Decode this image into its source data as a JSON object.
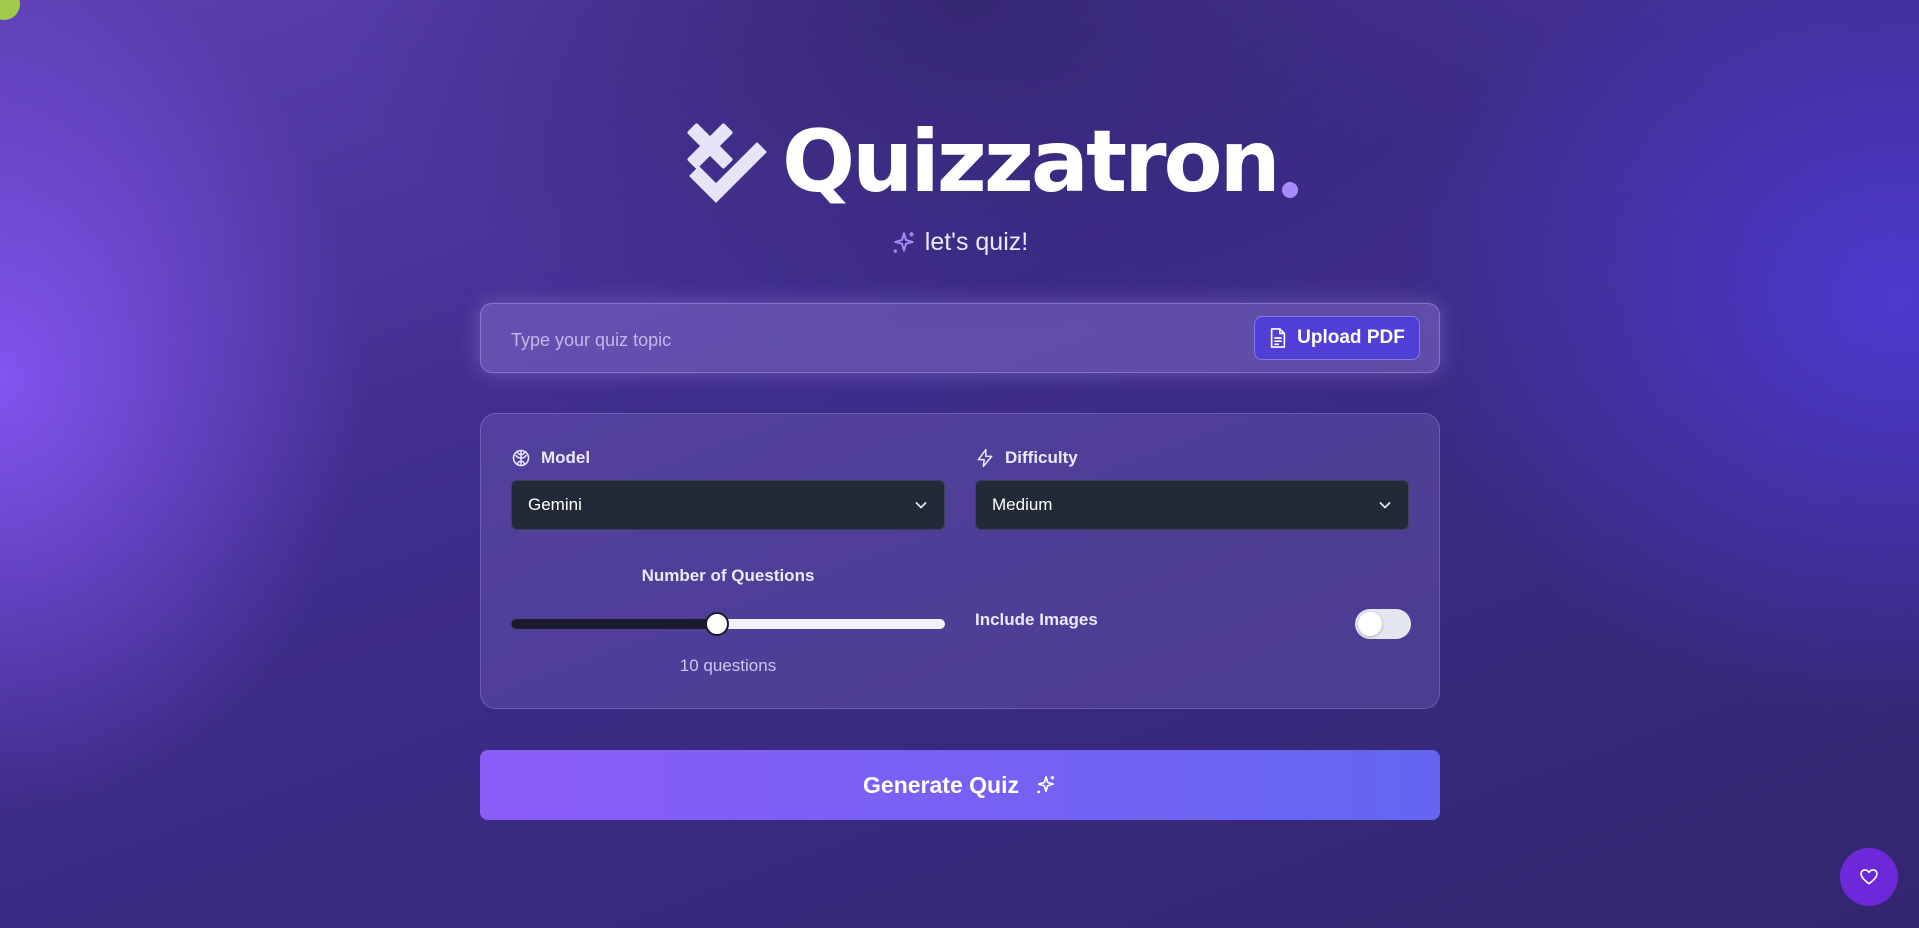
{
  "brand": {
    "name": "Quizzatron",
    "tagline": "let's quiz!",
    "dot_color": "#a78bfa",
    "logo_icon": "x-check-logo-icon"
  },
  "topic": {
    "placeholder": "Type your quiz topic",
    "value": "",
    "upload_label": "Upload PDF",
    "upload_icon": "file-icon"
  },
  "settings": {
    "model": {
      "label": "Model",
      "icon": "brain-icon",
      "selected": "Gemini"
    },
    "difficulty": {
      "label": "Difficulty",
      "icon": "zap-icon",
      "selected": "Medium"
    },
    "questions": {
      "label": "Number of Questions",
      "value": 10,
      "slider_fraction": 0.475,
      "value_text": "10 questions"
    },
    "images": {
      "label": "Include Images",
      "enabled": false
    }
  },
  "actions": {
    "generate_label": "Generate Quiz",
    "generate_icon": "sparkles-icon",
    "fab_icon": "heart-icon"
  },
  "colors": {
    "accent": "#8b5cf6",
    "accent_end": "#6366f1",
    "upload_bg": "#4f3fd6",
    "select_bg": "#222a38",
    "fab_bg": "#6d28d9",
    "corner_dot": "#a3c94a"
  }
}
